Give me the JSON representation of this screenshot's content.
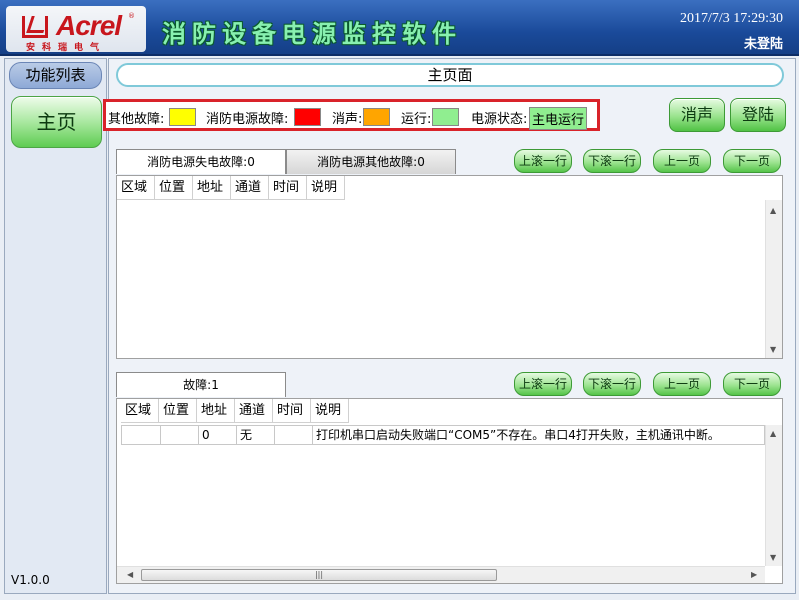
{
  "header": {
    "logo_text": "Acrel",
    "logo_sub": "安科瑞电气",
    "app_title": "消防设备电源监控软件",
    "datetime": "2017/7/3 17:29:30",
    "login_status": "未登陆"
  },
  "sidebar": {
    "func_list_label": "功能列表",
    "home_label": "主页",
    "version": "V1.0.0"
  },
  "main": {
    "page_title": "主页面",
    "legend": {
      "other_fault": "其他故障:",
      "power_fault": "消防电源故障:",
      "mute": "消声:",
      "running": "运行:",
      "power_state_label": "电源状态:",
      "power_state_value": "主电运行",
      "colors": {
        "other_fault": "#ffff00",
        "power_fault": "#ff0000",
        "mute": "#ffa500",
        "running": "#90ee90"
      }
    },
    "buttons": {
      "mute": "消声",
      "login": "登陆"
    },
    "top_panel": {
      "tabs": [
        "消防电源失电故障:0",
        "消防电源其他故障:0"
      ],
      "nav": [
        "上滚一行",
        "下滚一行",
        "上一页",
        "下一页"
      ],
      "columns": [
        "区域",
        "位置",
        "地址",
        "通道",
        "时间",
        "说明"
      ],
      "rows": []
    },
    "bottom_panel": {
      "tabs": [
        "故障:1"
      ],
      "nav": [
        "上滚一行",
        "下滚一行",
        "上一页",
        "下一页"
      ],
      "columns": [
        "区域",
        "位置",
        "地址",
        "通道",
        "时间",
        "说明"
      ],
      "rows": [
        {
          "area": "",
          "position": "",
          "address": "0",
          "channel": "无",
          "time": "",
          "desc": "打印机串口启动失败端口“COM5”不存在。串口4打开失败，主机通讯中断。"
        }
      ]
    }
  }
}
